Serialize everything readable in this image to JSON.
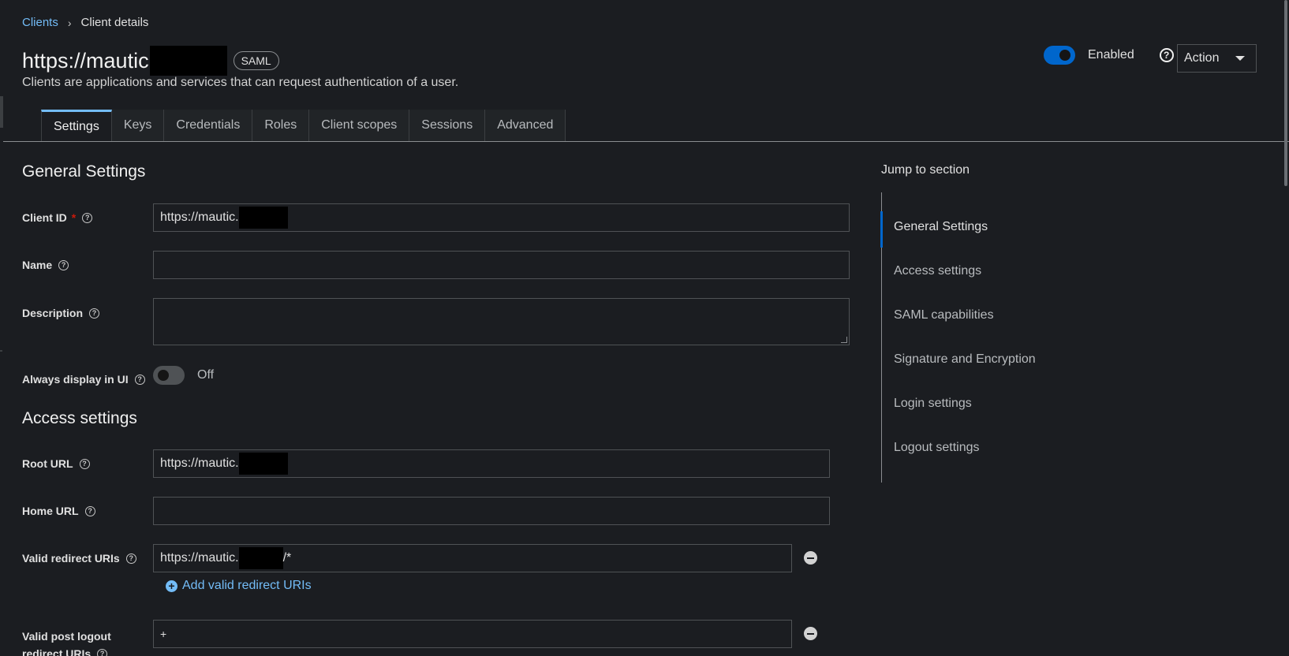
{
  "breadcrumb": {
    "clients": "Clients",
    "separator": "›",
    "current": "Client details"
  },
  "header": {
    "title": "https://mautic",
    "protocol_badge": "SAML",
    "subtitle": "Clients are applications and services that can request authentication of a user.",
    "enabled_label": "Enabled",
    "help_glyph": "?",
    "action_label": "Action"
  },
  "tabs": [
    {
      "label": "Settings",
      "active": true
    },
    {
      "label": "Keys"
    },
    {
      "label": "Credentials"
    },
    {
      "label": "Roles"
    },
    {
      "label": "Client scopes"
    },
    {
      "label": "Sessions"
    },
    {
      "label": "Advanced"
    }
  ],
  "general": {
    "title": "General Settings",
    "client_id_label": "Client ID",
    "required_mark": "*",
    "client_id_value": "https://mautic.",
    "name_label": "Name",
    "name_value": "",
    "description_label": "Description",
    "always_display_label": "Always display in UI",
    "always_display_state": "Off"
  },
  "access": {
    "title": "Access settings",
    "root_url_label": "Root URL",
    "root_url_value": "https://mautic.",
    "home_url_label": "Home URL",
    "home_url_value": "",
    "valid_redirect_label": "Valid redirect URIs",
    "valid_redirect_value": "https://mautic.",
    "valid_redirect_suffix": "/*",
    "add_redirect_label": "Add valid redirect URIs",
    "post_logout_label_line1": "Valid post logout",
    "post_logout_label_line2": "redirect URIs",
    "post_logout_value": "+"
  },
  "jump": {
    "title": "Jump to section",
    "items": [
      {
        "label": "General Settings",
        "active": true
      },
      {
        "label": "Access settings"
      },
      {
        "label": "SAML capabilities"
      },
      {
        "label": "Signature and Encryption"
      },
      {
        "label": "Login settings"
      },
      {
        "label": "Logout settings"
      }
    ]
  },
  "icons": {
    "help": "question-circle-icon",
    "remove": "minus-circle-icon",
    "add": "plus-circle-icon",
    "dropdown": "caret-down-icon"
  },
  "colors": {
    "background": "#1b1d21",
    "accent": "#0066cc",
    "link": "#73bcf7",
    "required": "#c9190b"
  }
}
